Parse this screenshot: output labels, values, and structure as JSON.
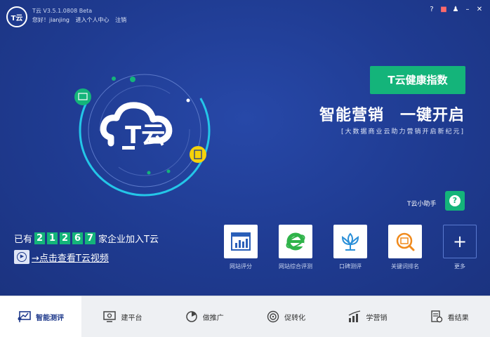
{
  "header": {
    "logo_text": "T云",
    "app_title": "T云 V3.5.1.0808 Beta",
    "greeting": "您好！jianjing",
    "enter_center": "进入个人中心",
    "logout": "注销"
  },
  "hero": {
    "center_logo_text": "T云",
    "health_button": "T云健康指数",
    "slogan_main": "智能营销　一键开启",
    "slogan_sub": "[大数据商业云助力营销开启新纪元]",
    "assistant_label": "T云小助手",
    "assistant_icon": "?"
  },
  "counter": {
    "prefix": "已有",
    "digits": [
      "2",
      "1",
      "2",
      "6",
      "7"
    ],
    "suffix": "家企业加入T云"
  },
  "video_link": "→点击查看T云视频",
  "tools": [
    {
      "label": "网站评分",
      "icon": "bar-chart-icon"
    },
    {
      "label": "网站综合评测",
      "icon": "ie-browser-icon"
    },
    {
      "label": "口碑测评",
      "icon": "lotus-icon"
    },
    {
      "label": "关键词排名",
      "icon": "keyword-icon"
    },
    {
      "label": "更多",
      "icon": "plus-icon",
      "glyph": "+"
    }
  ],
  "nav": [
    {
      "label": "智能测评",
      "active": true
    },
    {
      "label": "建平台"
    },
    {
      "label": "做推广"
    },
    {
      "label": "促转化"
    },
    {
      "label": "学营销"
    },
    {
      "label": "看结果"
    }
  ],
  "colors": {
    "background": "#1f3a8c",
    "accent_green": "#14b47a",
    "accent_yellow": "#f5d20a",
    "bottom_bar": "#eef0f3"
  }
}
